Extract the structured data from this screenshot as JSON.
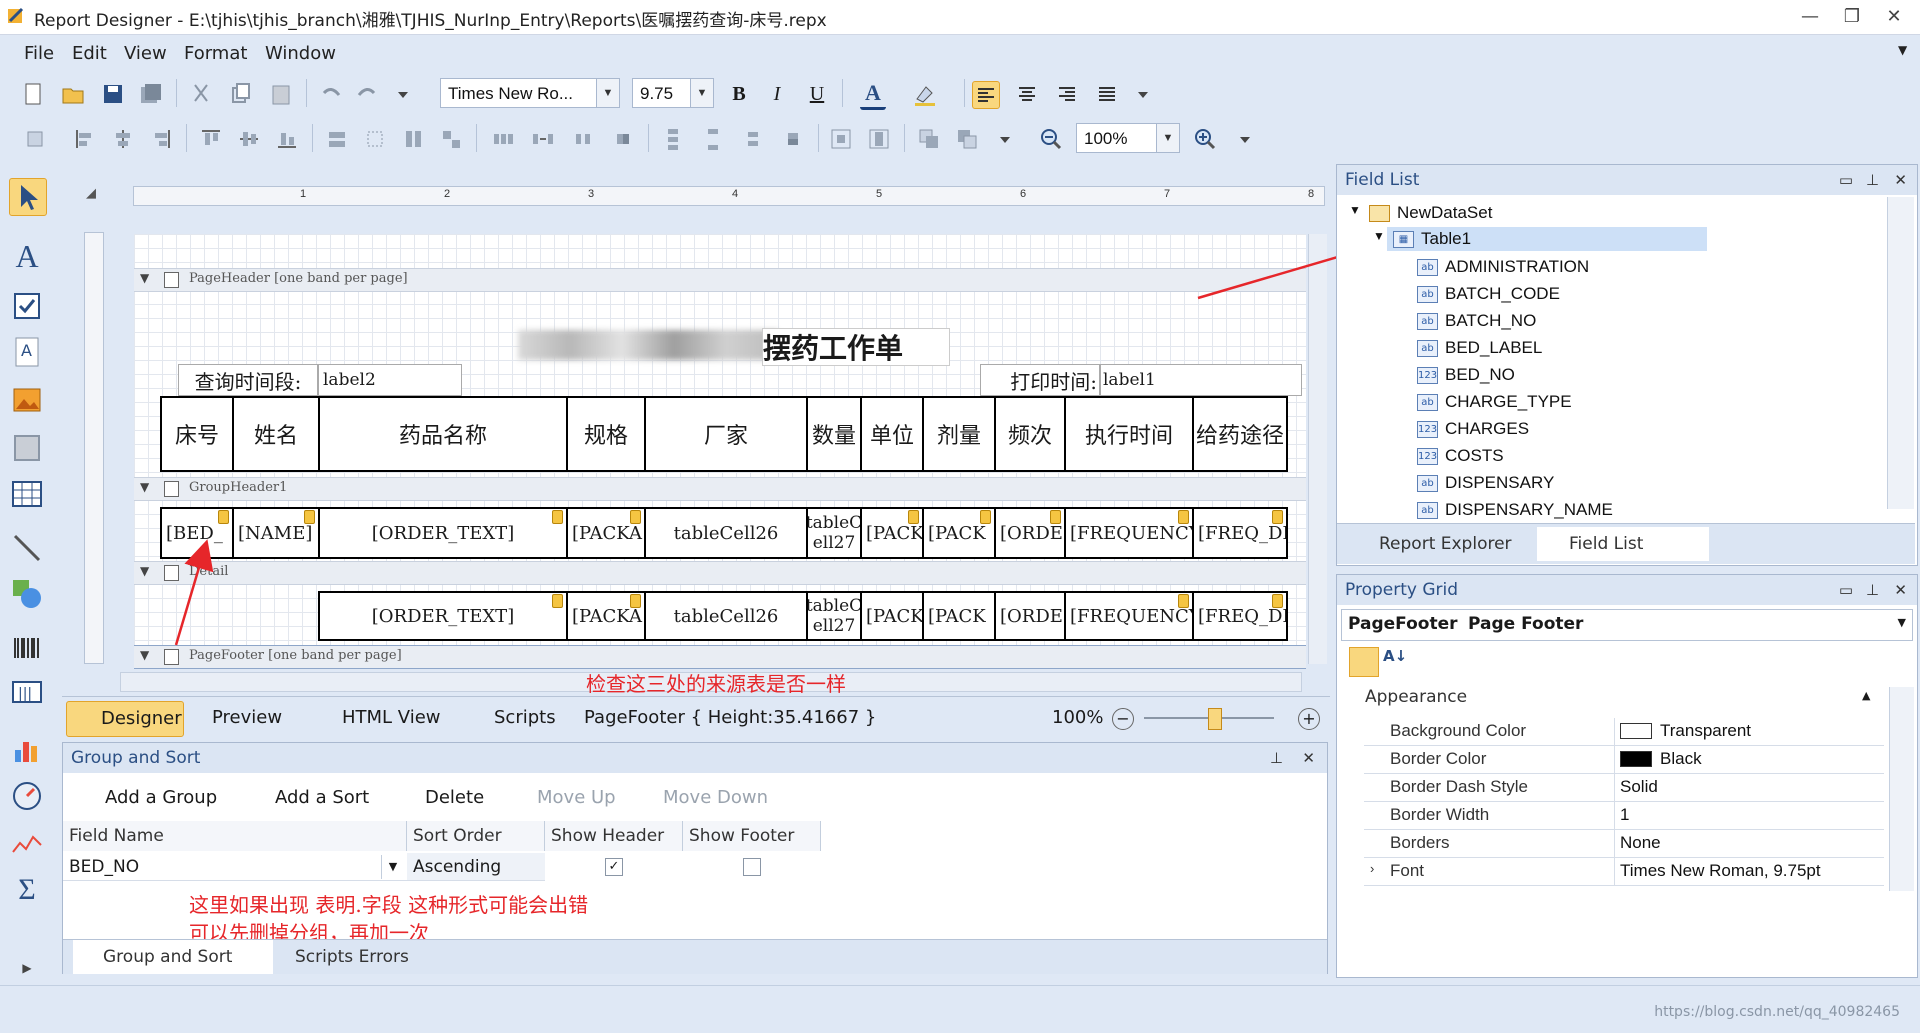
{
  "window": {
    "title": "Report Designer - E:\\tjhis\\tjhis_branch\\湘雅\\TJHIS_NurInp_Entry\\Reports\\医嘱摆药查询-床号.repx"
  },
  "menu": [
    "File",
    "Edit",
    "View",
    "Format",
    "Window"
  ],
  "toolbar": {
    "font_name": "Times New Ro...",
    "font_size": "9.75",
    "zoom": "100%"
  },
  "report": {
    "title_visible": "摆药工作单",
    "query_label": "查询时间段:",
    "query_value": "label2",
    "print_label": "打印时间:",
    "print_value": "label1",
    "headers": [
      "床号",
      "姓名",
      "药品名称",
      "规格",
      "厂家",
      "数量",
      "单位",
      "剂量",
      "频次",
      "执行时间",
      "给药途径"
    ],
    "group_row": [
      "[BED_",
      "[NAME]",
      "[ORDER_TEXT]",
      "[PACKA",
      "tableCell26",
      "tableC ell27",
      "[PACK",
      "[PACK",
      "[ORDE",
      "[FREQUENCY",
      "[FREQ_DE"
    ],
    "detail_row": [
      "[ORDER_TEXT]",
      "[PACKA",
      "tableCell26",
      "tableC ell27",
      "[PACK",
      "[PACK",
      "[ORDE",
      "[FREQUENCY",
      "[FREQ_DE"
    ]
  },
  "bands": {
    "page_header": "PageHeader [one band per page]",
    "group_header": "GroupHeader1",
    "detail": "Detail",
    "page_footer": "PageFooter [one band per page]"
  },
  "annotations": {
    "check_sources": "检查这三处的来源表是否一样",
    "note_line1": "这里如果出现   表明.字段  这种形式可能会出错",
    "note_line2": "可以先删掉分组，再加一次"
  },
  "bottom_tabs": {
    "designer": "Designer",
    "preview": "Preview",
    "html_view": "HTML View",
    "scripts": "Scripts",
    "status": "PageFooter { Height:35.41667 }",
    "zoom": "100%"
  },
  "group_sort": {
    "title": "Group and Sort",
    "add_group": "Add a Group",
    "add_sort": "Add a Sort",
    "delete": "Delete",
    "move_up": "Move Up",
    "move_down": "Move Down",
    "columns": [
      "Field Name",
      "Sort Order",
      "Show Header",
      "Show Footer"
    ],
    "row": {
      "field": "BED_NO",
      "order": "Ascending",
      "show_header": true,
      "show_footer": false
    },
    "tabs": [
      "Group and Sort",
      "Scripts Errors"
    ]
  },
  "field_list": {
    "title": "Field List",
    "dataset": "NewDataSet",
    "table": "Table1",
    "fields": [
      {
        "name": "ADMINISTRATION",
        "type": "ab"
      },
      {
        "name": "BATCH_CODE",
        "type": "ab"
      },
      {
        "name": "BATCH_NO",
        "type": "ab"
      },
      {
        "name": "BED_LABEL",
        "type": "ab"
      },
      {
        "name": "BED_NO",
        "type": "123"
      },
      {
        "name": "CHARGE_TYPE",
        "type": "ab"
      },
      {
        "name": "CHARGES",
        "type": "123"
      },
      {
        "name": "COSTS",
        "type": "123"
      },
      {
        "name": "DISPENSARY",
        "type": "ab"
      },
      {
        "name": "DISPENSARY_NAME",
        "type": "ab"
      }
    ],
    "tabs": [
      "Report Explorer",
      "Field List"
    ]
  },
  "property_grid": {
    "title": "Property Grid",
    "object_name": "PageFooter",
    "object_type": "Page Footer",
    "category": "Appearance",
    "rows": [
      {
        "key": "Background Color",
        "value": "Transparent"
      },
      {
        "key": "Border Color",
        "value": "Black"
      },
      {
        "key": "Border Dash Style",
        "value": "Solid"
      },
      {
        "key": "Border Width",
        "value": "1"
      },
      {
        "key": "Borders",
        "value": "None"
      },
      {
        "key": "Font",
        "value": "Times New Roman, 9.75pt"
      }
    ]
  },
  "watermark": "https://blog.csdn.net/qq_40982465",
  "colors": {
    "accent": "#2b4f84",
    "annotation": "#e6262a",
    "chrome": "#dfe8f5"
  }
}
